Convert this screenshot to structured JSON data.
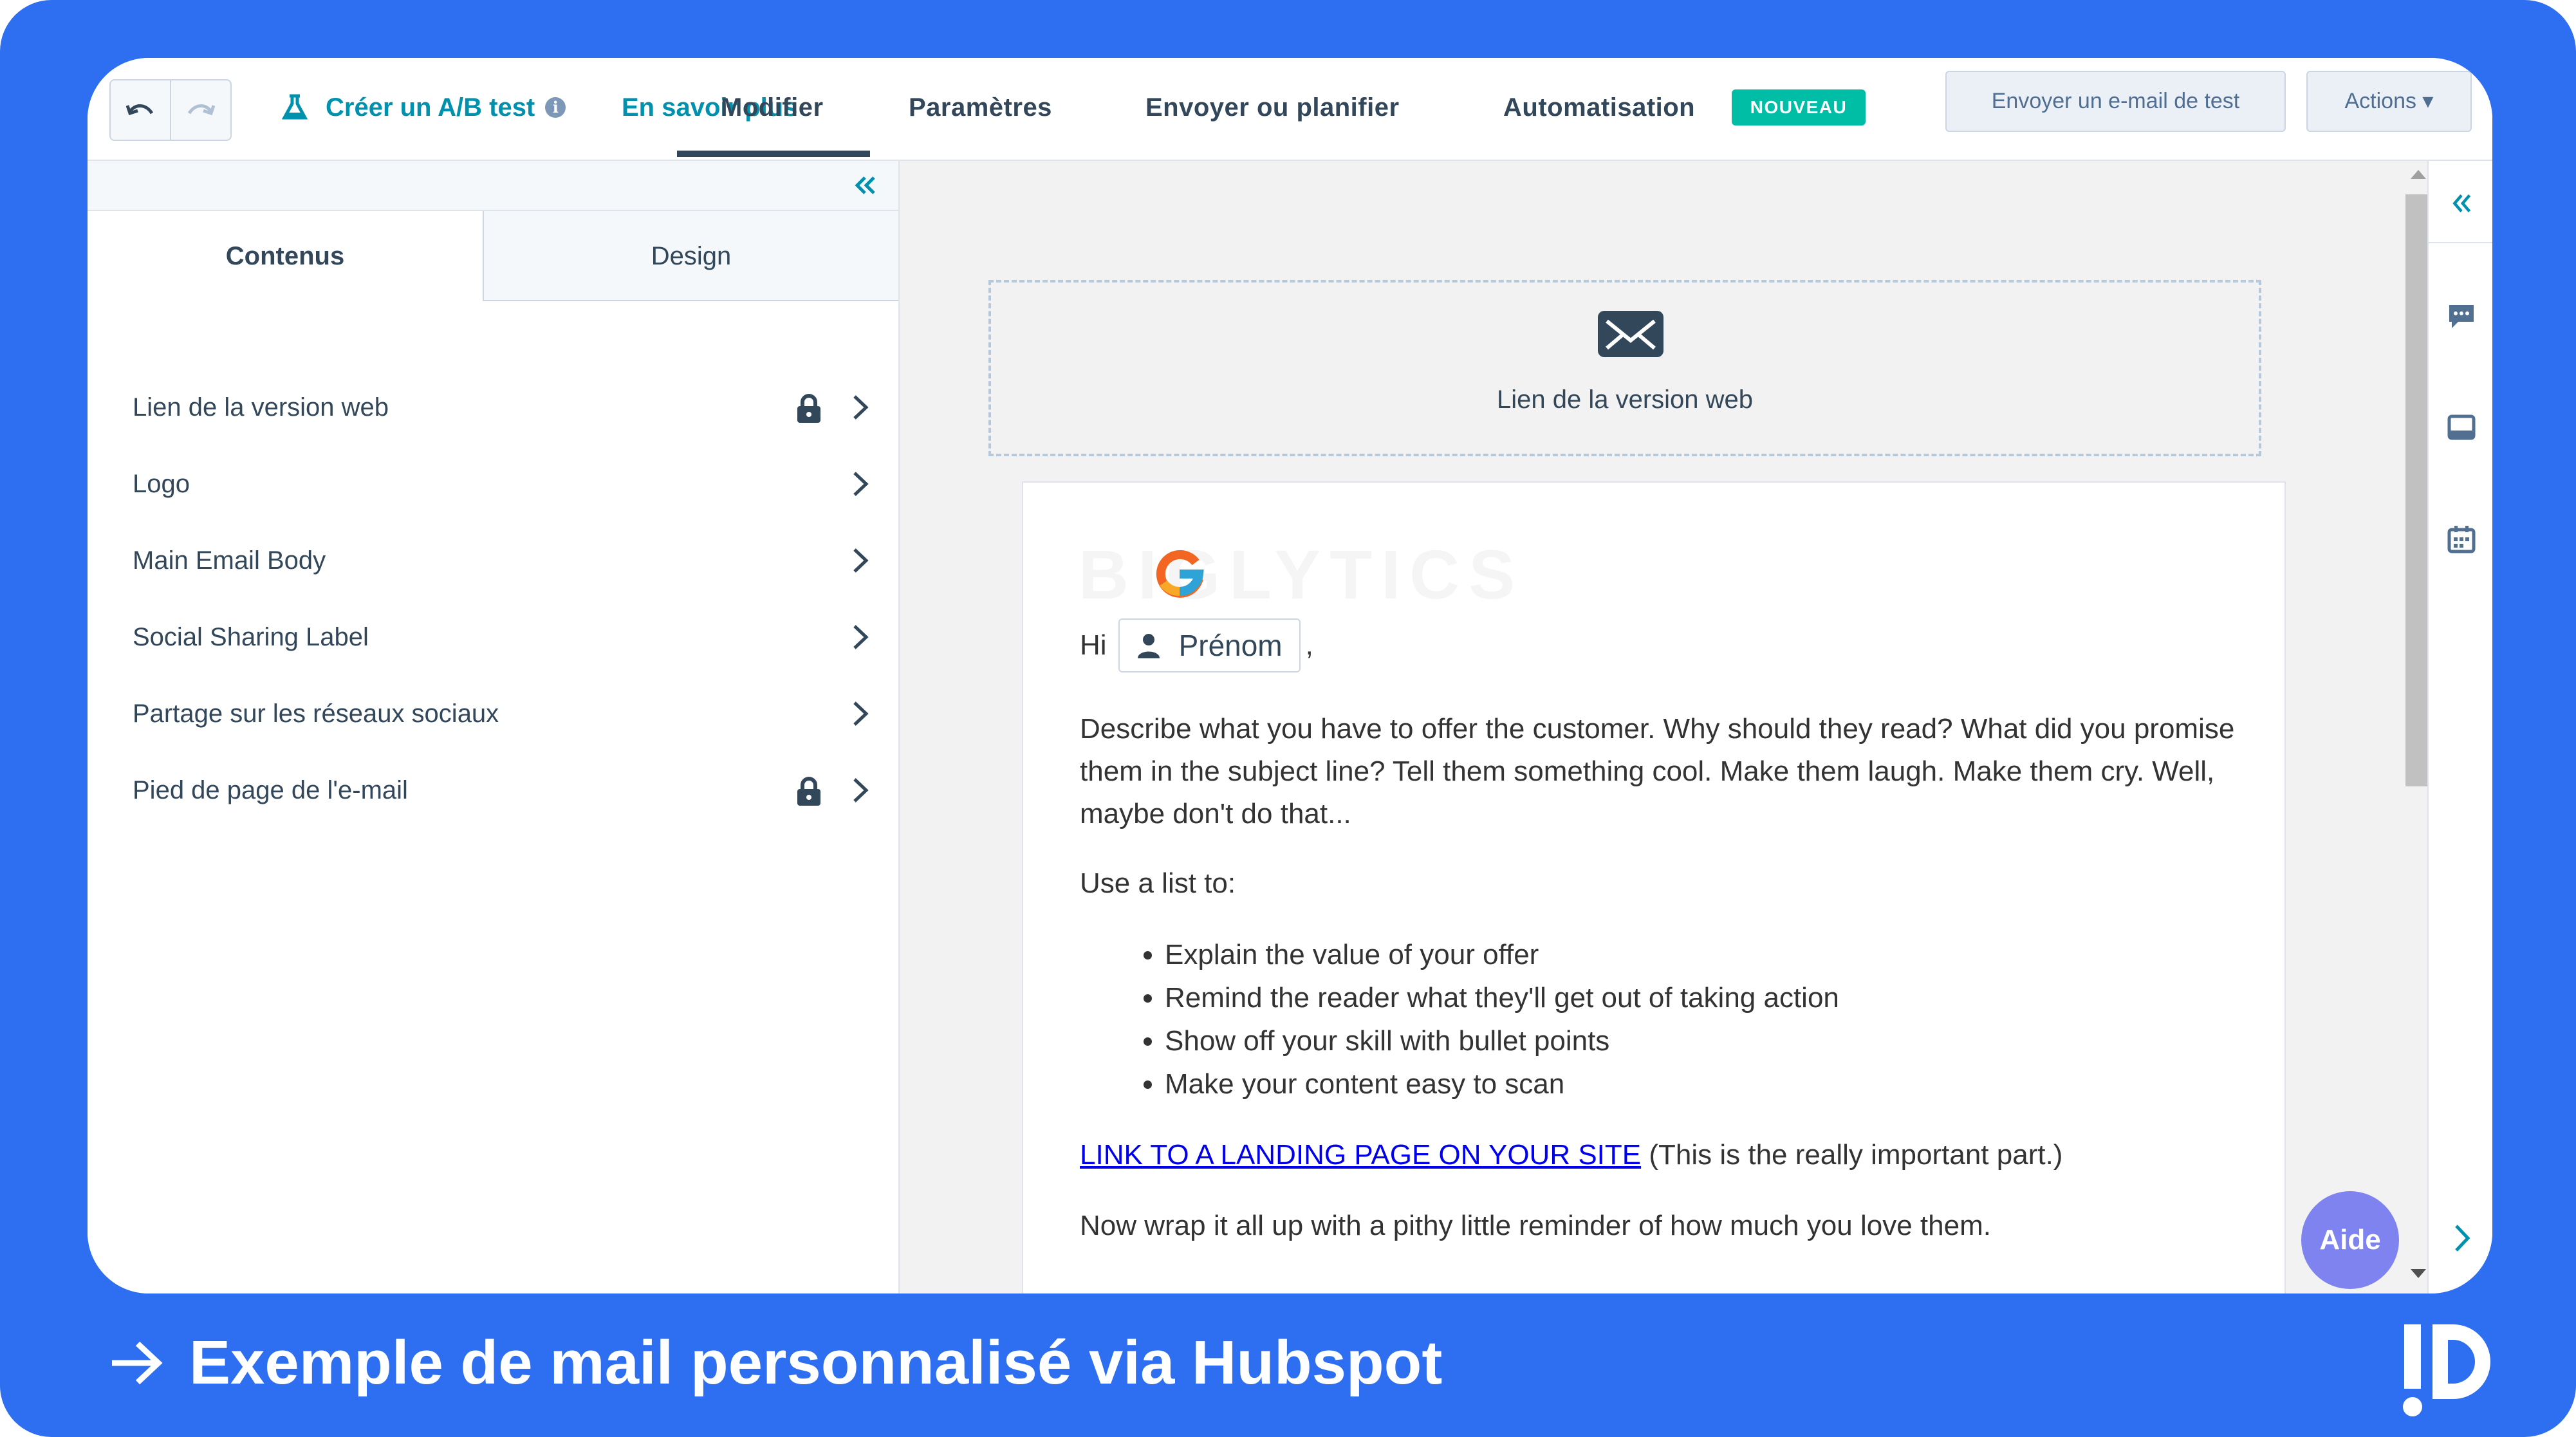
{
  "toolbar": {
    "ab_test_label": "Créer un A/B test",
    "info_glyph": "i",
    "learn_more": "En savoir plus",
    "tabs": {
      "modifier": "Modifier",
      "parametres": "Paramètres",
      "envoyer": "Envoyer ou planifier",
      "automatisation": "Automatisation"
    },
    "badge_new": "NOUVEAU",
    "test_email_button": "Envoyer un e-mail de test",
    "actions_button": "Actions ▾"
  },
  "left_panel": {
    "tabs": [
      "Contenus",
      "Design"
    ],
    "items": [
      {
        "label": "Lien de la version web",
        "locked": true
      },
      {
        "label": "Logo",
        "locked": false
      },
      {
        "label": "Main Email Body",
        "locked": false
      },
      {
        "label": "Social Sharing Label",
        "locked": false
      },
      {
        "label": "Partage sur les réseaux sociaux",
        "locked": false
      },
      {
        "label": "Pied de page de l'e-mail",
        "locked": true
      }
    ]
  },
  "email": {
    "web_version_label": "Lien de la version web",
    "logo_text": "BIGLYTICS",
    "greeting": "Hi",
    "token_label": "Prénom",
    "greeting_suffix": ",",
    "para1": "Describe what you have to offer the customer. Why should they read? What did you promise them in the subject line? Tell them something cool. Make them laugh. Make them cry. Well, maybe don't do that...",
    "list_intro": "Use a list to:",
    "bullets": [
      "Explain the value of your offer",
      "Remind the reader what they'll get out of taking action",
      "Show off your skill with bullet points",
      "Make your content easy to scan"
    ],
    "link_text": "LINK TO A LANDING PAGE ON YOUR SITE",
    "link_suffix": "(This is the really important part.)",
    "closing": "Now wrap it all up with a pithy little reminder of how much you love them."
  },
  "help_button": "Aide",
  "caption": "Exemple de mail personnalisé via Hubspot",
  "colors": {
    "frame": "#2e6ff2",
    "accent_teal": "#0091ae",
    "badge": "#00bda5",
    "help": "#7f83f0",
    "text": "#33475b"
  },
  "icons": [
    "undo-icon",
    "redo-icon",
    "flask-icon",
    "info-icon",
    "double-chevron-left-icon",
    "lock-icon",
    "chevron-right-icon",
    "envelope-icon",
    "person-icon",
    "comment-icon",
    "inbox-icon",
    "calendar-icon",
    "arrow-right-icon"
  ]
}
